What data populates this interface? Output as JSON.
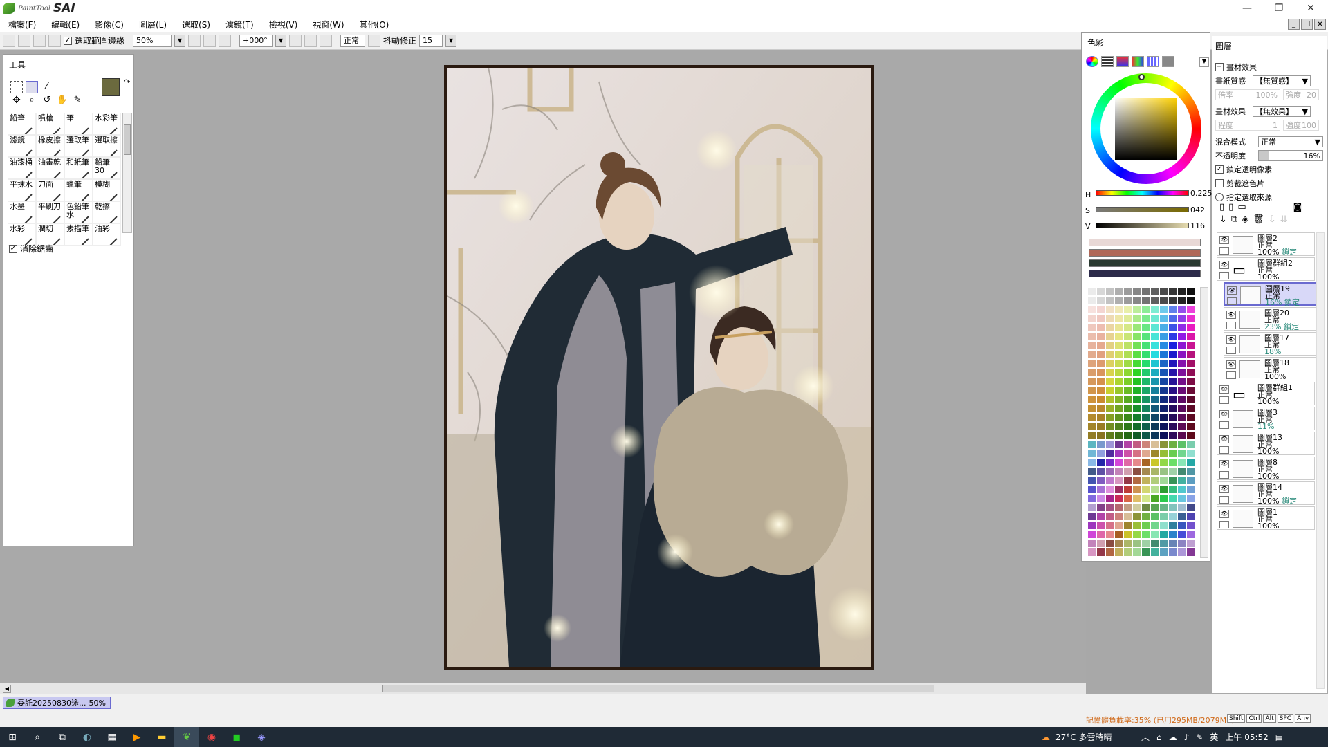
{
  "app": {
    "logo_small": "PaintTool",
    "logo_big": "SAI"
  },
  "window_controls": {
    "minimize": "—",
    "restore": "❐",
    "close": "✕"
  },
  "menu": [
    "檔案(F)",
    "編輯(E)",
    "影像(C)",
    "圖層(L)",
    "選取(S)",
    "濾鏡(T)",
    "檢視(V)",
    "視窗(W)",
    "其他(O)"
  ],
  "toolbar": {
    "selection_edge_label": "選取範圍邊緣",
    "zoom": "50%",
    "rotation": "+000°",
    "blend": "正常",
    "stabilizer_label": "抖動修正",
    "stabilizer_value": "15"
  },
  "tools": {
    "title": "工具",
    "brushes": [
      "鉛筆",
      "噴槍",
      "筆",
      "水彩筆",
      "濾鏡",
      "橡皮擦",
      "選取筆",
      "選取擦",
      "油漆桶",
      "油畫乾",
      "和紙筆",
      "鉛筆30",
      "平抹水",
      "刀面",
      "蠟筆",
      "模糊",
      "水墨",
      "平刷刀",
      "色鉛筆水",
      "乾擦",
      "水彩",
      "潤切",
      "素描筆",
      "油彩"
    ],
    "antialias_label": "消除鋸齒",
    "primary_color": "#6b6a3e",
    "secondary_color": "#a5a07a"
  },
  "colors": {
    "title": "色彩",
    "h_label": "H",
    "h_value": "0.225",
    "s_label": "S",
    "s_value": "042",
    "v_label": "V",
    "v_value": "116",
    "recent": [
      "#e8d8d6",
      "#b06858",
      "#2a3a30",
      "#2c2a4a"
    ]
  },
  "layers": {
    "title": "圖層",
    "paper_effect_label": "畫材效果",
    "texture_label": "畫紙質感",
    "texture_value": "【無質感】",
    "texture_scale": "倍率",
    "texture_scale_val": "100%",
    "texture_strength": "強度",
    "texture_strength_val": "20",
    "effect_label": "畫材效果",
    "effect_value": "【無效果】",
    "effect_degree": "程度",
    "effect_degree_val": "1",
    "effect_strength": "強度",
    "effect_strength_val": "100",
    "blend_label": "混合模式",
    "blend_value": "正常",
    "opacity_label": "不透明度",
    "opacity_value": "16%",
    "opacity_fraction": 0.16,
    "lock_alpha_label": "鎖定透明像素",
    "clip_label": "剪裁遮色片",
    "select_source_label": "指定選取來源",
    "items": [
      {
        "name": "圖層2",
        "mode": "正常",
        "opacity": "100%",
        "lock": "鎖定"
      },
      {
        "name": "圖層群組2",
        "mode": "正常",
        "opacity": "100%",
        "lock": ""
      },
      {
        "name": "圖層19",
        "mode": "正常",
        "opacity": "16%",
        "lock": "鎖定"
      },
      {
        "name": "圖層20",
        "mode": "正常",
        "opacity": "23%",
        "lock": "鎖定"
      },
      {
        "name": "圖層17",
        "mode": "正常",
        "opacity": "18%",
        "lock": ""
      },
      {
        "name": "圖層18",
        "mode": "正常",
        "opacity": "100%",
        "lock": ""
      },
      {
        "name": "圖層群組1",
        "mode": "正常",
        "opacity": "100%",
        "lock": ""
      },
      {
        "name": "圖層3",
        "mode": "正常",
        "opacity": "11%",
        "lock": ""
      },
      {
        "name": "圖層13",
        "mode": "正常",
        "opacity": "100%",
        "lock": ""
      },
      {
        "name": "圖層8",
        "mode": "正常",
        "opacity": "100%",
        "lock": ""
      },
      {
        "name": "圖層14",
        "mode": "正常",
        "opacity": "100%",
        "lock": "鎖定"
      },
      {
        "name": "圖層1",
        "mode": "正常",
        "opacity": "100%",
        "lock": ""
      }
    ]
  },
  "status": {
    "doc_tab": "委託20250830途...",
    "doc_zoom": "50%",
    "memory": "記憶體負載率:35% (已用295MB/2079MB)",
    "keys": [
      "Shift",
      "Ctrl",
      "Alt",
      "SPC",
      "Any"
    ]
  },
  "taskbar": {
    "weather": "27°C 多雲時晴",
    "ime": "英",
    "time": "上午 05:52"
  }
}
